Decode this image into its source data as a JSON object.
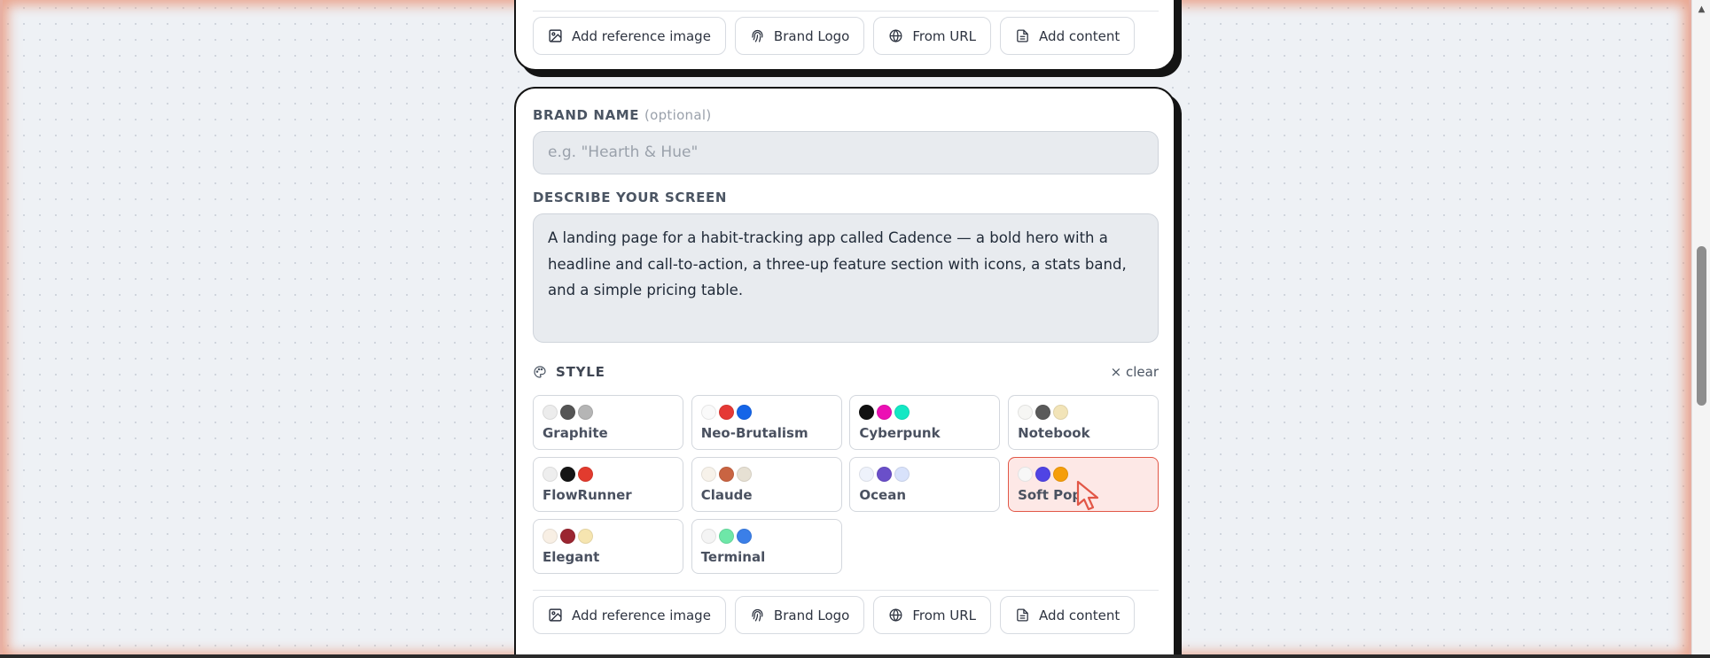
{
  "attachments": {
    "add_reference_image": "Add reference image",
    "brand_logo": "Brand Logo",
    "from_url": "From URL",
    "add_content": "Add content"
  },
  "brand": {
    "label": "BRAND NAME",
    "optional": "(optional)",
    "placeholder": "e.g. \"Hearth & Hue\""
  },
  "describe": {
    "label": "DESCRIBE YOUR SCREEN",
    "value": "A landing page for a habit-tracking app called Cadence — a bold hero with a headline and call-to-action, a three-up feature section with icons, a stats band, and a simple pricing table."
  },
  "style": {
    "title": "STYLE",
    "clear": "× clear",
    "selected": "Soft Pop",
    "options": [
      {
        "name": "Graphite",
        "colors": [
          "#ececec",
          "#555555",
          "#b5b5b5"
        ]
      },
      {
        "name": "Neo-Brutalism",
        "colors": [
          "#fafafa",
          "#e53935",
          "#1565e8"
        ]
      },
      {
        "name": "Cyberpunk",
        "colors": [
          "#111111",
          "#ec0fb4",
          "#13e8c4"
        ]
      },
      {
        "name": "Notebook",
        "colors": [
          "#f6f6f4",
          "#5a5a5a",
          "#f2e4b8"
        ]
      },
      {
        "name": "FlowRunner",
        "colors": [
          "#eeeeee",
          "#151515",
          "#e23b2e"
        ]
      },
      {
        "name": "Claude",
        "colors": [
          "#f7f2ea",
          "#c96442",
          "#e6e0d3"
        ]
      },
      {
        "name": "Ocean",
        "colors": [
          "#eef2fb",
          "#6a4fc9",
          "#d8e2fb"
        ]
      },
      {
        "name": "Soft Pop",
        "colors": [
          "#f7f7f7",
          "#5044e4",
          "#f59e0b"
        ]
      },
      {
        "name": "Elegant",
        "colors": [
          "#f8efe4",
          "#9b2631",
          "#f6e5b0"
        ]
      },
      {
        "name": "Terminal",
        "colors": [
          "#f4f4f4",
          "#6ee7a8",
          "#3b7fe8"
        ]
      }
    ]
  }
}
